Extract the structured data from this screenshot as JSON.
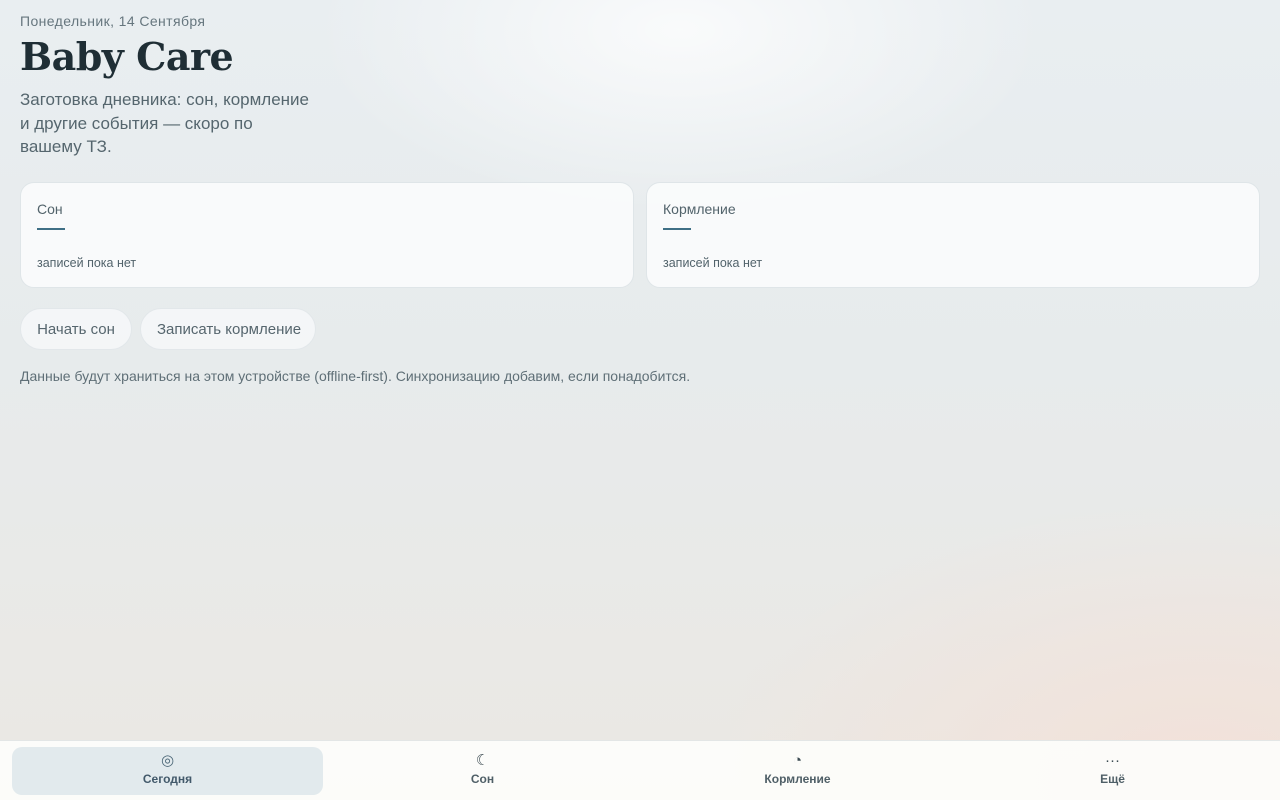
{
  "header": {
    "date": "Понедельник, 14 Сентября",
    "title": "Baby Care",
    "subtitle": "Заготовка дневника: сон, кормление и другие события — скоро по вашему ТЗ."
  },
  "cards": [
    {
      "label": "Сон",
      "value": "—",
      "note": "записей пока нет"
    },
    {
      "label": "Кормление",
      "value": "—",
      "note": "записей пока нет"
    }
  ],
  "actions": {
    "start_sleep": "Начать сон",
    "log_feeding": "Записать кормление"
  },
  "storage_note": "Данные будут храниться на этом устройстве (offline-first). Синхронизацию добавим, если понадобится.",
  "tabbar": {
    "active_tab": "Сегодня",
    "tabs": [
      {
        "label": "Сегодня",
        "icon": "today-icon",
        "glyph": "◎"
      },
      {
        "label": "Сон",
        "icon": "moon-icon",
        "glyph": "☾"
      },
      {
        "label": "Кормление",
        "icon": "feeding-icon",
        "glyph": "◔"
      },
      {
        "label": "Ещё",
        "icon": "more-icon",
        "glyph": "···"
      }
    ]
  },
  "colors": {
    "accent": "#3f6f85",
    "title": "#1f2e35",
    "active_tab_bg": "#e2eaed"
  }
}
